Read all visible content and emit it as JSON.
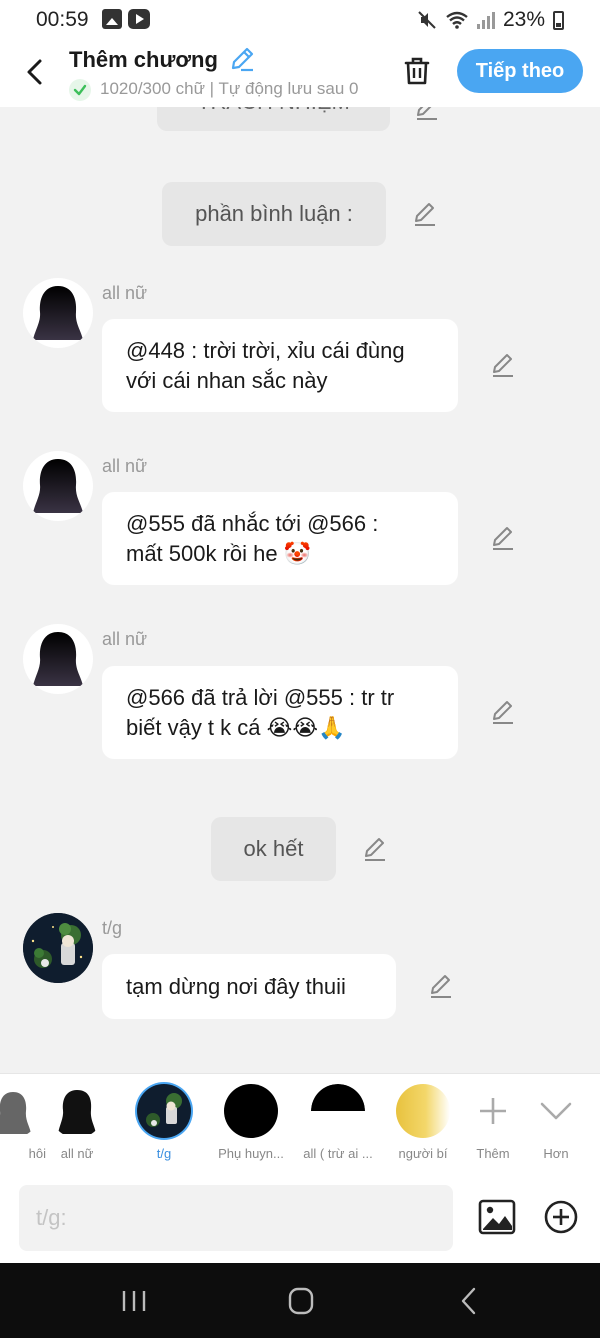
{
  "status_bar": {
    "time": "00:59",
    "battery": "23%"
  },
  "header": {
    "title": "Thêm chương",
    "subtitle": "1020/300 chữ | Tự động lưu sau 0",
    "next_label": "Tiếp theo"
  },
  "chat": {
    "top_partial_text": "TRÁCH NHIỆM",
    "narration_1": "phần bình luận :",
    "messages": [
      {
        "sender": "all nữ",
        "line1": "@448 : trời trời, xỉu cái đùng",
        "line2": "với cái nhan sắc này"
      },
      {
        "sender": "all nữ",
        "line1": "@555 đã nhắc tới @566 :",
        "line2": "mất 500k rồi he 🤡"
      },
      {
        "sender": "all nữ",
        "line1": "@566 đã trả lời @555 : tr tr",
        "line2": "biết vậy t k cá 😭😭🙏"
      }
    ],
    "narration_2": "ok hết",
    "last_message": {
      "sender": "t/g",
      "text": "tạm dừng nơi đây thuii"
    }
  },
  "characters": [
    {
      "label": "hôi"
    },
    {
      "label": "all nữ"
    },
    {
      "label": "t/g"
    },
    {
      "label": "Phụ huyn..."
    },
    {
      "label": "all ( trừ ai ..."
    },
    {
      "label": "người bí"
    },
    {
      "label": "Thêm"
    },
    {
      "label": "Hơn"
    }
  ],
  "input": {
    "placeholder": "t/g:"
  },
  "colors": {
    "accent": "#4aa6f2",
    "background": "#f2f2f2",
    "bubble": "#ffffff",
    "narration": "#e6e6e6"
  }
}
